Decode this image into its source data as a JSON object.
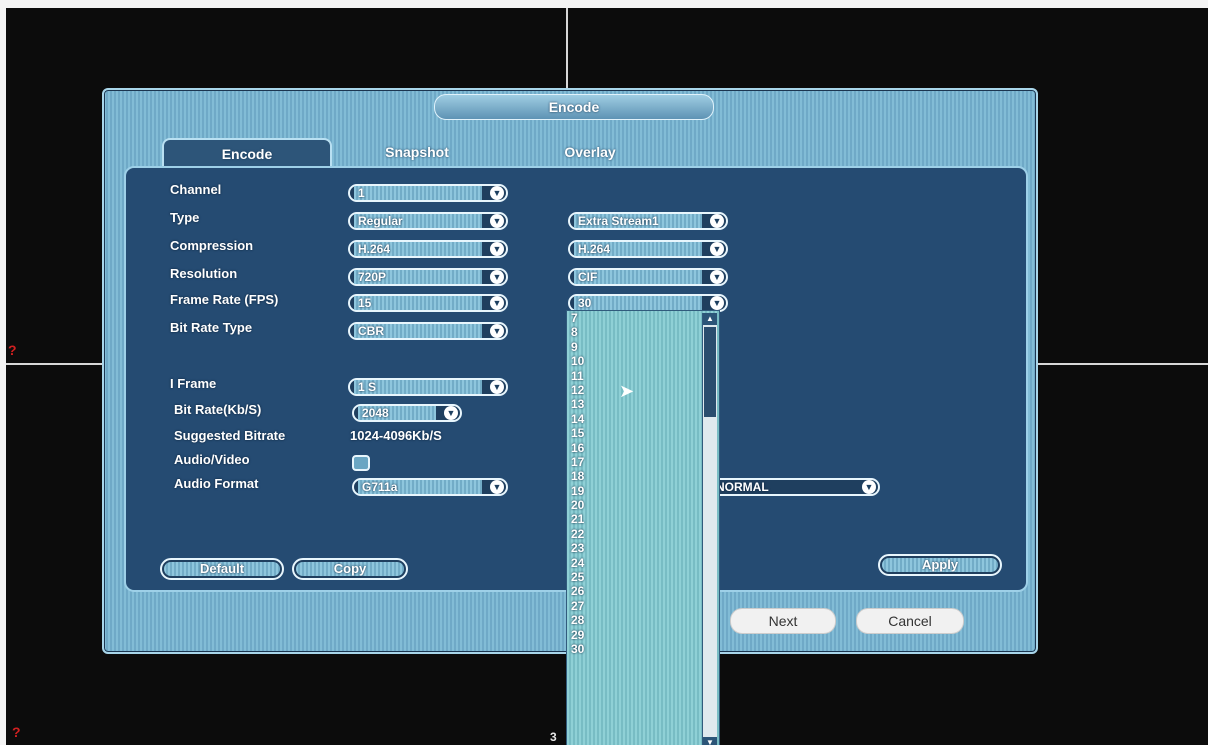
{
  "window": {
    "title": "Encode"
  },
  "tabs": [
    {
      "label": "Encode",
      "active": true
    },
    {
      "label": "Snapshot",
      "active": false
    },
    {
      "label": "Overlay",
      "active": false
    }
  ],
  "form": {
    "channel": {
      "label": "Channel",
      "value": "1"
    },
    "type": {
      "label": "Type",
      "main": "Regular",
      "extra": "Extra Stream1"
    },
    "compression": {
      "label": "Compression",
      "main": "H.264",
      "extra": "H.264"
    },
    "resolution": {
      "label": "Resolution",
      "main": "720P",
      "extra": "CIF"
    },
    "frame_rate": {
      "label": "Frame Rate (FPS)",
      "main": "15",
      "extra": "30"
    },
    "bit_rate_type": {
      "label": "Bit Rate Type",
      "main": "CBR"
    },
    "i_frame": {
      "label": "I Frame",
      "main": "1 S"
    },
    "bit_rate": {
      "label": "Bit Rate(Kb/S)",
      "main": "2048"
    },
    "suggested_bitrate": {
      "label": "Suggested Bitrate",
      "value": "1024-4096Kb/S"
    },
    "audio_video": {
      "label": "Audio/Video",
      "checked": false
    },
    "audio_format": {
      "label": "Audio Format",
      "main": "G711a",
      "extra": "NORMAL"
    }
  },
  "buttons": {
    "default": "Default",
    "copy": "Copy",
    "apply": "Apply",
    "next": "Next",
    "cancel": "Cancel"
  },
  "fps_dropdown": {
    "options": [
      "7",
      "8",
      "9",
      "10",
      "11",
      "12",
      "13",
      "14",
      "15",
      "16",
      "17",
      "18",
      "19",
      "20",
      "21",
      "22",
      "23",
      "24",
      "25",
      "26",
      "27",
      "28",
      "29",
      "30"
    ]
  },
  "background": {
    "channel_number": "3",
    "channel_alert": "?"
  },
  "colors": {
    "dialog_bg": "#6fa9c7",
    "panel_bg": "#254b72",
    "dropdown_bg": "#8fd0d6"
  }
}
